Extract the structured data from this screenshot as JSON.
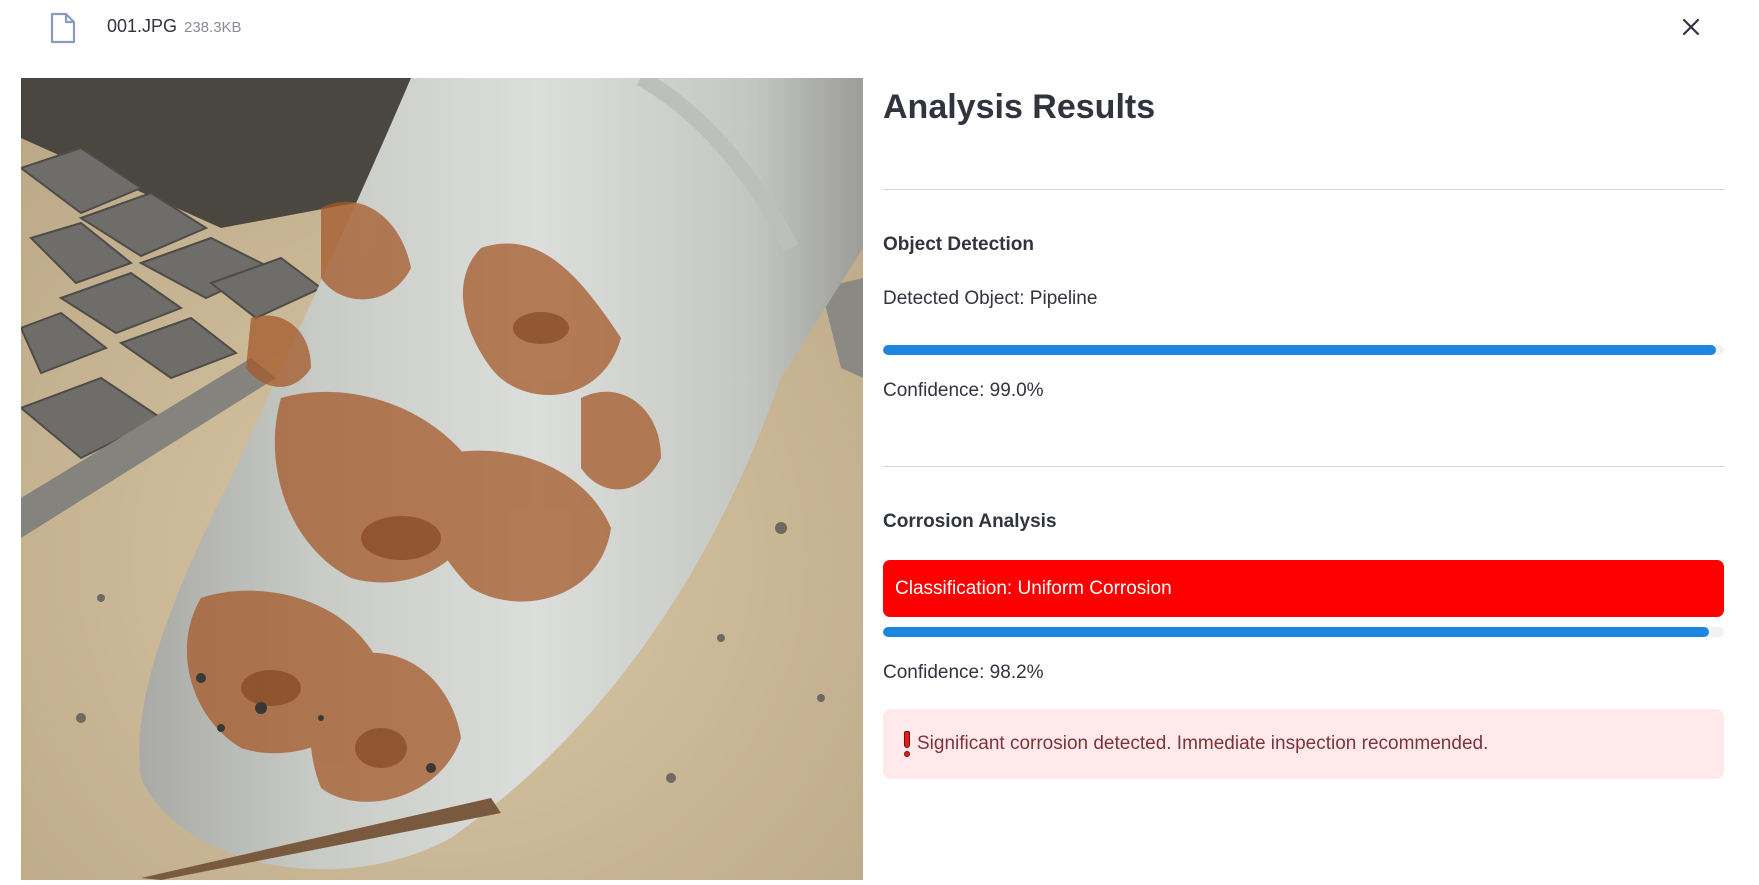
{
  "file": {
    "name": "001.JPG",
    "size": "238.3KB",
    "icon": "file-icon",
    "close_icon": "close-icon"
  },
  "results": {
    "title": "Analysis Results",
    "object_detection": {
      "heading": "Object Detection",
      "detected_label": "Detected Object: Pipeline",
      "confidence_percent": 99.0,
      "confidence_label": "Confidence: 99.0%"
    },
    "corrosion_analysis": {
      "heading": "Corrosion Analysis",
      "classification_label": "Classification: Uniform Corrosion",
      "confidence_percent": 98.2,
      "confidence_label": "Confidence: 98.2%",
      "alert_icon": "exclamation-icon",
      "alert_text": "Significant corrosion detected. Immediate inspection recommended."
    }
  },
  "colors": {
    "progress_fill": "#1f86e0",
    "classification_background": "#ff0000",
    "alert_background": "#ffe9ea",
    "alert_text": "#7d353b"
  }
}
